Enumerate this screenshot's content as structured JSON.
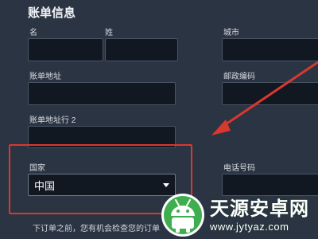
{
  "section_title": "账单信息",
  "labels": {
    "first_name": "名",
    "last_name": "姓",
    "city": "城市",
    "billing_address": "账单地址",
    "postcode": "邮政编码",
    "billing_address_2": "账单地址行 2",
    "country": "国家",
    "phone": "电话号码"
  },
  "country_select": {
    "value": "中国"
  },
  "footer_note": "下订单之前，您有机会检查您的订单",
  "watermark": {
    "brand": "天源安卓网",
    "url": "www.jytyaz.com"
  },
  "colors": {
    "background": "#2b3442",
    "field": "#111821",
    "highlight": "#d9382f",
    "logo_green": "#3fae4f"
  }
}
